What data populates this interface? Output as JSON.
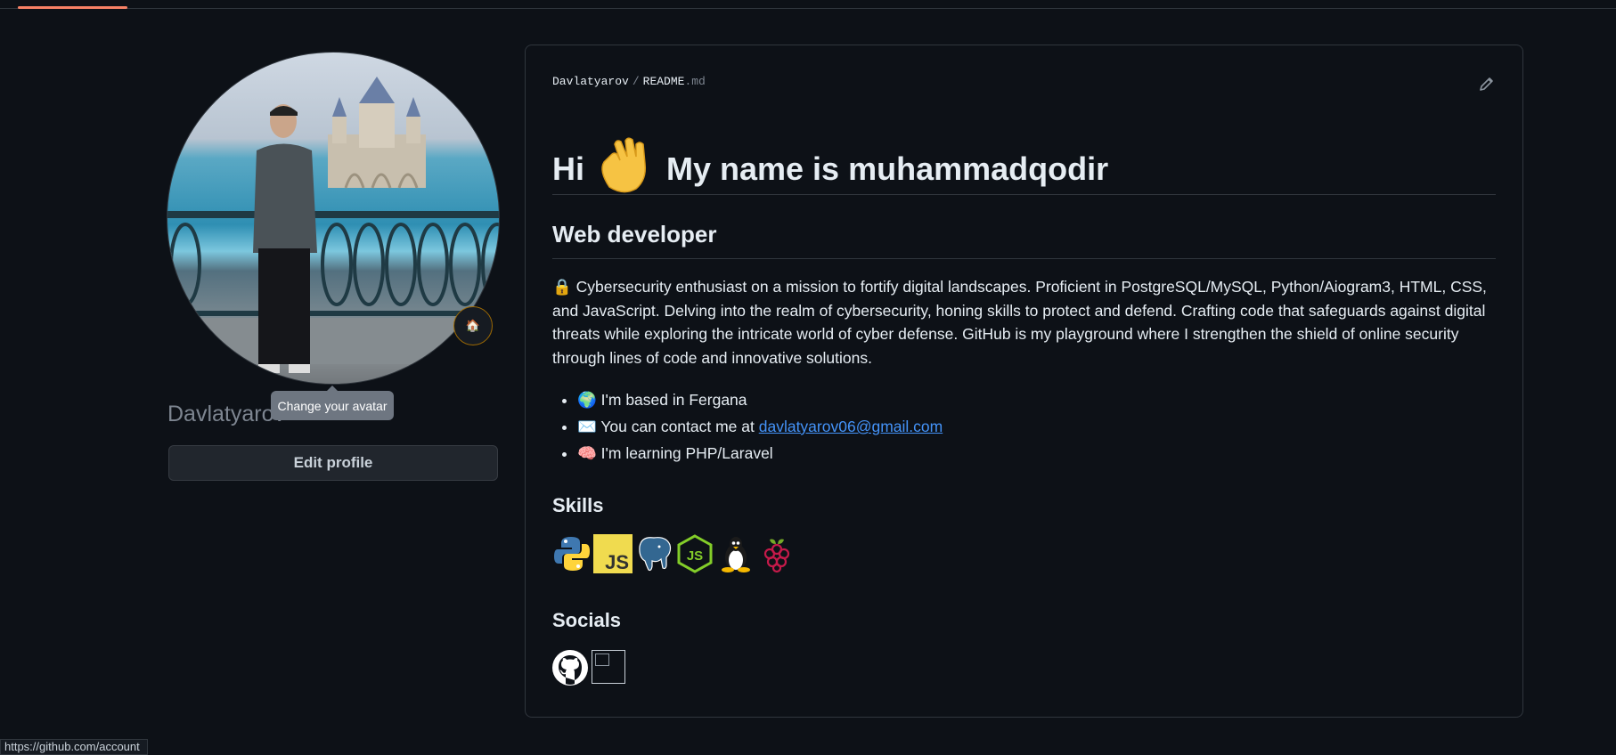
{
  "profile": {
    "username": "Davlatyarov",
    "tooltip": "Change your avatar",
    "edit_profile_label": "Edit profile",
    "status_emoji": "🏠"
  },
  "readme": {
    "breadcrumb": {
      "owner": "Davlatyarov",
      "separator": "/",
      "file": "README",
      "ext": ".md"
    },
    "title_hi": "Hi",
    "title_rest": "My name is muhammadqodir",
    "subtitle": "Web developer",
    "about": "Cybersecurity enthusiast on a mission to fortify digital landscapes. Proficient in PostgreSQL/MySQL, Python/Aiogram3, HTML, CSS, and JavaScript. Delving into the realm of cybersecurity, honing skills to protect and defend. Crafting code that safeguards against digital threats while exploring the intricate world of cyber defense. GitHub is my playground where I strengthen the shield of online security through lines of code and innovative solutions.",
    "list": [
      {
        "emoji": "🌍",
        "text": "I'm based in Fergana"
      },
      {
        "emoji": "✉️",
        "text": "You can contact me at ",
        "link": "davlatyarov06@gmail.com"
      },
      {
        "emoji": "🧠",
        "text": "I'm learning PHP/Laravel"
      }
    ],
    "skills_heading": "Skills",
    "skills": [
      "python-icon",
      "javascript-icon",
      "postgresql-icon",
      "nodejs-icon",
      "linux-icon",
      "raspberry-pi-icon"
    ],
    "socials_heading": "Socials",
    "socials": [
      "github-icon",
      "broken-image-icon"
    ]
  },
  "status_bar": {
    "url": "https://github.com/account"
  },
  "colors": {
    "accent_tab": "#f78166",
    "link": "#4493f8",
    "background": "#0d1117",
    "border": "#30363d"
  }
}
